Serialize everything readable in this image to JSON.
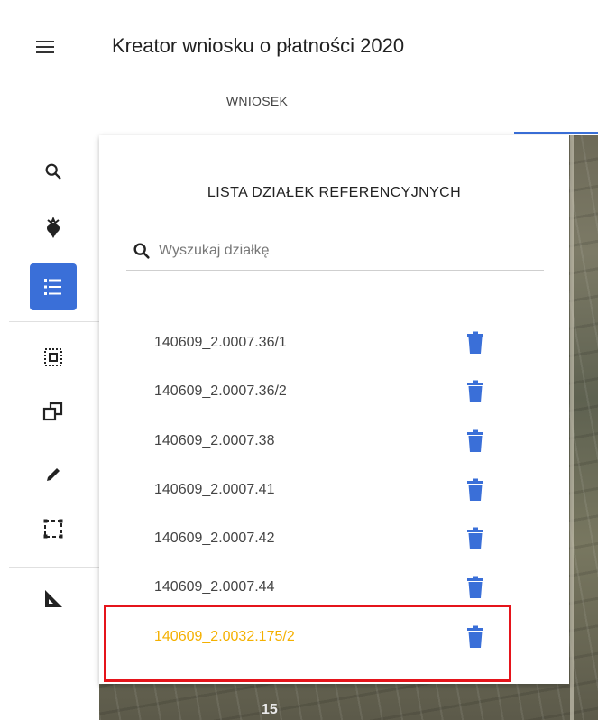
{
  "header": {
    "title": "Kreator wniosku o płatności 2020",
    "tab_label": "WNIOSEK"
  },
  "toolbar": {
    "tools": [
      "search-icon",
      "beet-icon",
      "list-icon",
      "select-parcel-icon",
      "copy-icon",
      "pencil-icon",
      "rectangle-select-icon",
      "ruler-triangle-icon"
    ],
    "active_tool": "list-icon"
  },
  "panel": {
    "title": "LISTA DZIAŁEK REFERENCYJNYCH",
    "search_placeholder": "Wyszukaj działkę",
    "items": [
      {
        "label": "140609_2.0007.36/1"
      },
      {
        "label": "140609_2.0007.36/2"
      },
      {
        "label": "140609_2.0007.38"
      },
      {
        "label": "140609_2.0007.41"
      },
      {
        "label": "140609_2.0007.42"
      },
      {
        "label": "140609_2.0007.44"
      },
      {
        "label": "140609_2.0032.175/2",
        "highlighted": true
      }
    ]
  },
  "map": {
    "partial_label": "15"
  },
  "colors": {
    "accent": "#3a6fd8",
    "highlight_text": "#f4b000",
    "highlight_box": "#e5141b"
  }
}
